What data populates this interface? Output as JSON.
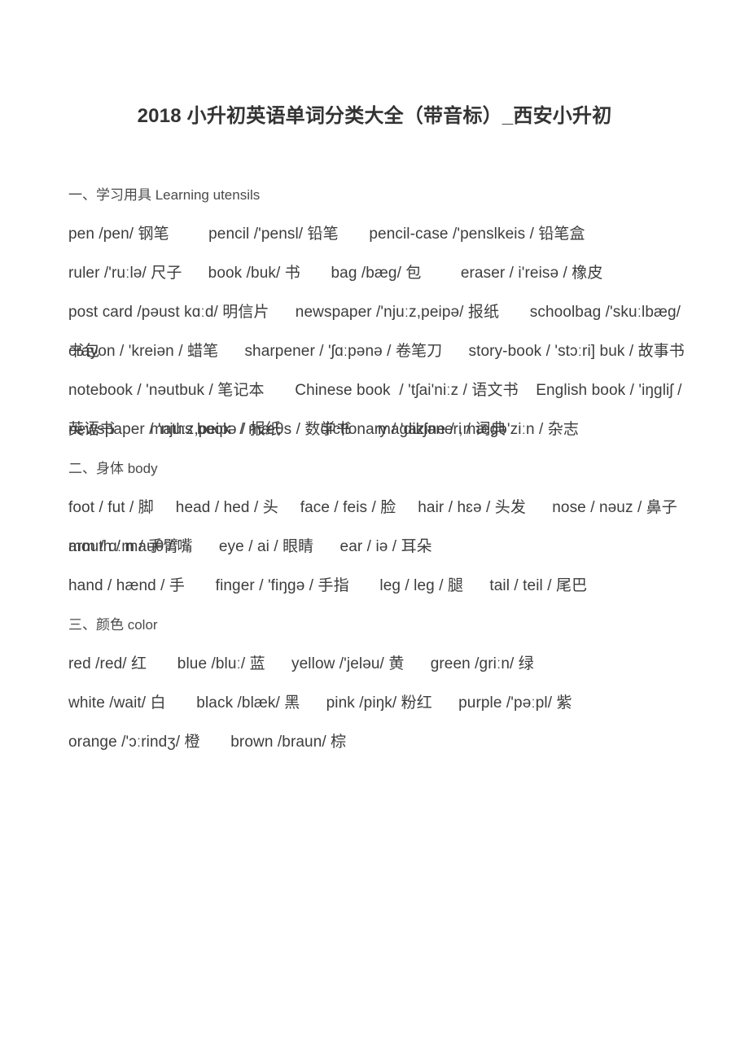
{
  "document": {
    "title": "2018 小升初英语单词分类大全（带音标）_西安小升初",
    "page_background": "#ffffff",
    "text_color": "#3d3d3d"
  },
  "sections": [
    {
      "heading": "一、学习用具 Learning utensils",
      "lines": [
        "pen /pen/ 钢笔         pencil /'pensl/ 铅笔       pencil-case /'penslkeis / 铅笔盒",
        "ruler /'ruːlə/ 尺子      book /buk/ 书       bag /bæg/ 包         eraser / i'reisə / 橡皮",
        "post card /pəust kɑːd/ 明信片      newspaper /'njuːz,peipə/ 报纸       schoolbag /'skuːlbæg/ 书包",
        "crayon / 'kreiən / 蜡笔      sharpener / 'ʃɑːpənə / 卷笔刀      story-book / 'stɔːri] buk / 故事书",
        "notebook / 'nəutbuk / 笔记本       Chinese book  / 'tʃai'niːz / 语文书    English book / 'iŋgliʃ / 英语书        maths book  / mæθs / 数学书      magazine / ,mægə'ziːn / 杂志",
        "newspaper / 'njuːz,peipə / 报纸         dictionary / 'dikʃəneri / 词典"
      ]
    },
    {
      "heading": "二、身体 body",
      "lines": [
        "foot / fut / 脚     head / hed / 头     face / feis / 脸     hair / hɛə / 头发      nose / nəuz / 鼻子      mouth / mauθ / 嘴      eye / ai / 眼睛      ear / iə / 耳朵",
        "arm / ɑːm / 手臂",
        "hand / hænd / 手       finger / 'fiŋgə / 手指       leg / leg / 腿      tail / teil / 尾巴"
      ]
    },
    {
      "heading": "三、颜色  color",
      "lines": [
        "red /red/ 红       blue /bluː/ 蓝      yellow /'jeləu/ 黄      green /griːn/ 绿",
        "white /wait/ 白       black /blæk/ 黑      pink /piŋk/ 粉红      purple /'pəːpl/ 紫",
        "orange /'ɔːrindʒ/ 橙       brown /braun/ 棕"
      ]
    }
  ]
}
